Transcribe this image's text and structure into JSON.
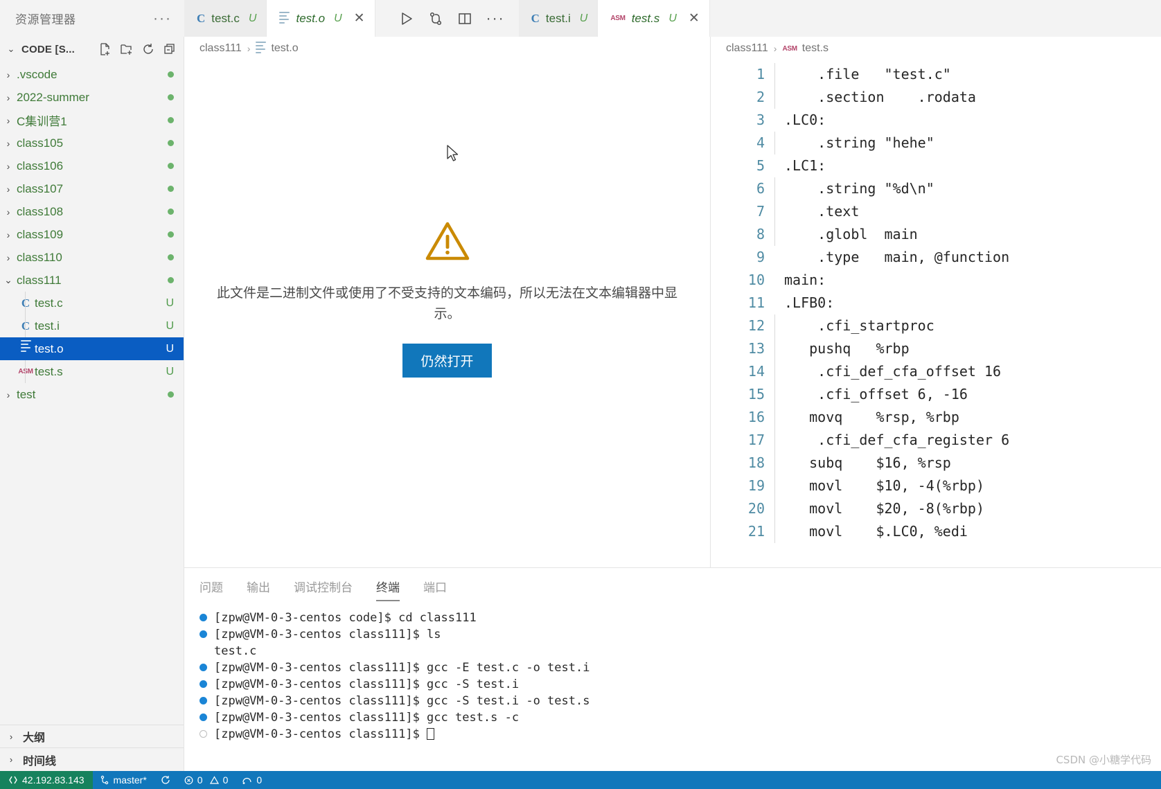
{
  "explorer": {
    "title": "资源管理器",
    "more_label": "···",
    "root_label": "CODE [S...",
    "actions": [
      "new-file",
      "new-folder",
      "refresh",
      "collapse-all"
    ],
    "items": [
      {
        "label": ".vscode",
        "type": "folder",
        "expanded": false,
        "badge": "",
        "dot": true
      },
      {
        "label": "2022-summer",
        "type": "folder",
        "expanded": false,
        "badge": "",
        "dot": true
      },
      {
        "label": "C集训营1",
        "type": "folder",
        "expanded": false,
        "badge": "",
        "dot": true
      },
      {
        "label": "class105",
        "type": "folder",
        "expanded": false,
        "badge": "",
        "dot": true
      },
      {
        "label": "class106",
        "type": "folder",
        "expanded": false,
        "badge": "",
        "dot": true
      },
      {
        "label": "class107",
        "type": "folder",
        "expanded": false,
        "badge": "",
        "dot": true
      },
      {
        "label": "class108",
        "type": "folder",
        "expanded": false,
        "badge": "",
        "dot": true
      },
      {
        "label": "class109",
        "type": "folder",
        "expanded": false,
        "badge": "",
        "dot": true
      },
      {
        "label": "class110",
        "type": "folder",
        "expanded": false,
        "badge": "",
        "dot": true
      },
      {
        "label": "class111",
        "type": "folder",
        "expanded": true,
        "badge": "",
        "dot": true
      },
      {
        "label": "test.c",
        "type": "file-c",
        "badge": "U",
        "selected": false,
        "nested": true
      },
      {
        "label": "test.i",
        "type": "file-c",
        "badge": "U",
        "selected": false,
        "nested": true
      },
      {
        "label": "test.o",
        "type": "file-bin",
        "badge": "U",
        "selected": true,
        "nested": true
      },
      {
        "label": "test.s",
        "type": "file-asm",
        "badge": "U",
        "selected": false,
        "nested": true
      },
      {
        "label": "test",
        "type": "folder",
        "expanded": false,
        "badge": "",
        "dot": true
      }
    ],
    "bottom_sections": [
      {
        "label": "大纲"
      },
      {
        "label": "时间线"
      }
    ]
  },
  "tabs_left": [
    {
      "label": "test.c",
      "icon": "c-icon",
      "badge": "U",
      "active": false,
      "closable": false
    },
    {
      "label": "test.o",
      "icon": "bin-icon",
      "badge": "U",
      "active": true,
      "closable": true
    }
  ],
  "tabs_right": [
    {
      "label": "test.i",
      "icon": "c-icon",
      "badge": "U",
      "active": false,
      "closable": false
    },
    {
      "label": "test.s",
      "icon": "asm-icon",
      "badge": "U",
      "active": true,
      "closable": true
    }
  ],
  "editor_actions": [
    "run-icon",
    "source-control-icon",
    "split-editor-icon",
    "more-actions-icon"
  ],
  "breadcrumb_left": {
    "folder": "class111",
    "separator": "›",
    "file": "test.o",
    "file_icon": "bin-icon"
  },
  "breadcrumb_right": {
    "folder": "class111",
    "separator": "›",
    "file": "test.s",
    "file_icon": "asm-icon"
  },
  "binary_notice": {
    "icon": "warning-triangle-icon",
    "message": "此文件是二进制文件或使用了不受支持的文本编码，所以无法在文本编辑器中显示。",
    "button_label": "仍然打开"
  },
  "code": {
    "language": "assembly",
    "first_line": 1,
    "lines": [
      "    .file   \"test.c\"",
      "    .section    .rodata",
      ".LC0:",
      "    .string \"hehe\"",
      ".LC1:",
      "    .string \"%d\\n\"",
      "    .text",
      "    .globl  main",
      "    .type   main, @function",
      "main:",
      ".LFB0:",
      "    .cfi_startproc",
      "   pushq   %rbp",
      "    .cfi_def_cfa_offset 16",
      "    .cfi_offset 6, -16",
      "   movq    %rsp, %rbp",
      "    .cfi_def_cfa_register 6",
      "   subq    $16, %rsp",
      "   movl    $10, -4(%rbp)",
      "   movl    $20, -8(%rbp)",
      "   movl    $.LC0, %edi"
    ]
  },
  "panel": {
    "tabs": [
      {
        "label": "问题",
        "active": false
      },
      {
        "label": "输出",
        "active": false
      },
      {
        "label": "调试控制台",
        "active": false
      },
      {
        "label": "终端",
        "active": true
      },
      {
        "label": "端口",
        "active": false
      }
    ],
    "terminal_lines": [
      {
        "bullet": "filled",
        "text": "[zpw@VM-0-3-centos code]$ cd class111"
      },
      {
        "bullet": "filled",
        "text": "[zpw@VM-0-3-centos class111]$ ls"
      },
      {
        "bullet": "none",
        "text": "test.c"
      },
      {
        "bullet": "filled",
        "text": "[zpw@VM-0-3-centos class111]$ gcc -E test.c -o test.i"
      },
      {
        "bullet": "filled",
        "text": "[zpw@VM-0-3-centos class111]$ gcc -S test.i"
      },
      {
        "bullet": "filled",
        "text": "[zpw@VM-0-3-centos class111]$ gcc -S test.i -o test.s"
      },
      {
        "bullet": "filled",
        "text": "[zpw@VM-0-3-centos class111]$ gcc test.s -c"
      },
      {
        "bullet": "hollow",
        "text": "[zpw@VM-0-3-centos class111]$ ",
        "caret": true
      }
    ]
  },
  "statusbar": {
    "remote_label": "42.192.83.143",
    "branch_label": "master*",
    "sync_icon": "sync-icon",
    "errors": "0",
    "warnings": "0",
    "ports_label": "0",
    "colors": {
      "accent": "#1177bb",
      "remote": "#16825d"
    }
  },
  "watermark": "CSDN @小糖学代码"
}
